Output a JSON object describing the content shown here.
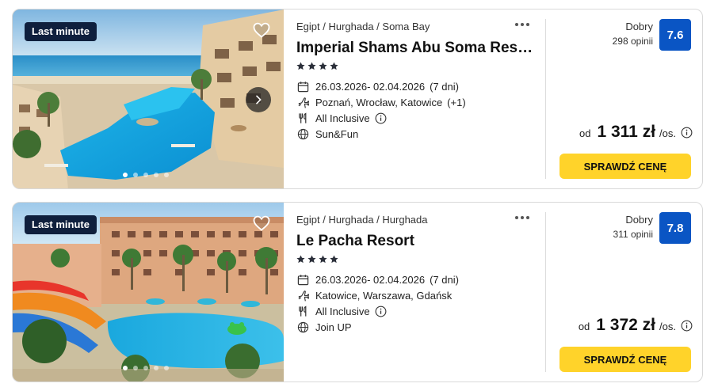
{
  "offers": [
    {
      "badge": "Last minute",
      "location": "Egipt / Hurghada / Soma Bay",
      "name": "Imperial Shams Abu Soma Resort",
      "stars": 4,
      "dates": "26.03.2026- 02.04.2026",
      "duration": "(7 dni)",
      "departure": "Poznań, Wrocław, Katowice",
      "departure_extra": "(+1)",
      "board": "All Inclusive",
      "program": "Sun&Fun",
      "rating_label": "Dobry",
      "reviews": "298 opinii",
      "score": "7.6",
      "price_prefix": "od",
      "price": "1 311 zł",
      "price_suffix": "/os.",
      "cta": "SPRAWDŹ CENĘ",
      "photo_index": 1,
      "photo_count": 5
    },
    {
      "badge": "Last minute",
      "location": "Egipt / Hurghada / Hurghada",
      "name": "Le Pacha Resort",
      "stars": 4,
      "dates": "26.03.2026- 02.04.2026",
      "duration": "(7 dni)",
      "departure": "Katowice, Warszawa, Gdańsk",
      "departure_extra": "",
      "board": "All Inclusive",
      "program": "Join UP",
      "rating_label": "Dobry",
      "reviews": "311 opinii",
      "score": "7.8",
      "price_prefix": "od",
      "price": "1 372 zł",
      "price_suffix": "/os.",
      "cta": "SPRAWDŹ CENĘ",
      "photo_index": 1,
      "photo_count": 5
    }
  ],
  "colors": {
    "badge_bg": "#0f1f3d",
    "score_bg": "#0a55c4",
    "cta_bg": "#ffd32a"
  }
}
